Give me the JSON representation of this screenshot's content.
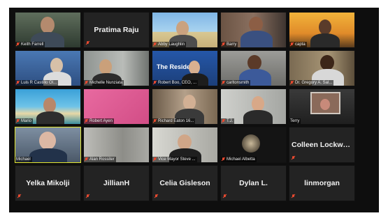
{
  "participants": [
    {
      "name": "Keith Farrell",
      "type": "video"
    },
    {
      "name": "Pratima Raju",
      "type": "name"
    },
    {
      "name": "Abby Laughlin",
      "type": "video"
    },
    {
      "name": "Barry",
      "type": "video"
    },
    {
      "name": "capta",
      "type": "video"
    },
    {
      "name": "Luis R Castillo Ol...",
      "type": "video"
    },
    {
      "name": "Michelle Nunziata",
      "type": "video"
    },
    {
      "name": "Robert Boo, CEO, ...",
      "type": "video"
    },
    {
      "name": "carltonsmith",
      "type": "video"
    },
    {
      "name": "Dr. Gregory A. Sal...",
      "type": "video"
    },
    {
      "name": "Mario",
      "type": "video"
    },
    {
      "name": "Robert Ayen",
      "type": "video"
    },
    {
      "name": "Richard Eaton 16...",
      "type": "video"
    },
    {
      "name": "T.J.",
      "type": "video"
    },
    {
      "name": "Terry",
      "type": "video"
    },
    {
      "name": "Michael",
      "type": "video",
      "active": true
    },
    {
      "name": "Alan Rossiter",
      "type": "video"
    },
    {
      "name": "Vice Mayor Steve ...",
      "type": "video"
    },
    {
      "name": "Michael Albetta",
      "type": "video"
    },
    {
      "name": "Colleen Lockwo...",
      "type": "name"
    },
    {
      "name": "Yelka Mikolji",
      "type": "name"
    },
    {
      "name": "JillianH",
      "type": "name"
    },
    {
      "name": "Celia Gisleson",
      "type": "name"
    },
    {
      "name": "Dylan L.",
      "type": "name"
    },
    {
      "name": "linmorgan",
      "type": "name"
    }
  ],
  "screen_text": {
    "resident_banner": "The Residen"
  },
  "colors": {
    "active_speaker_border": "#e3e630",
    "muted_mic": "#e84a30"
  }
}
